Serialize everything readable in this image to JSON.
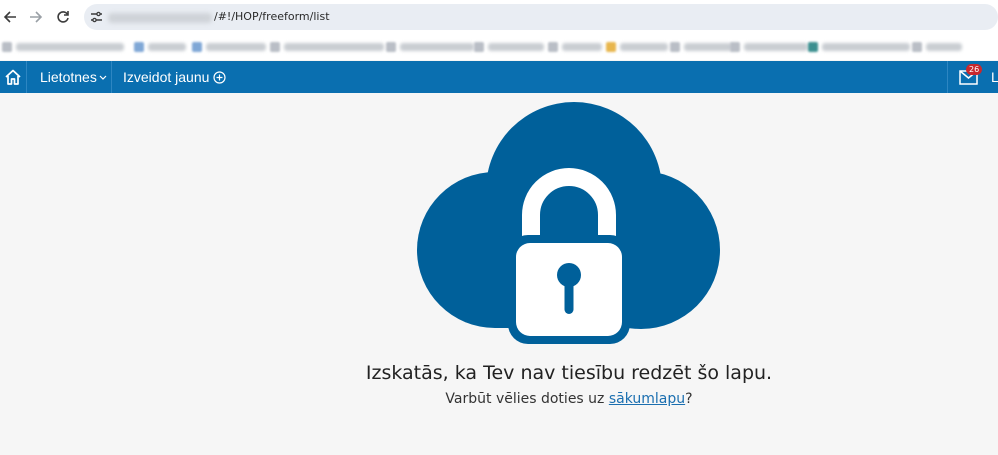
{
  "browser": {
    "url_visible": "/#!/HOP/freeform/list"
  },
  "appbar": {
    "menu_apps": "Lietotnes",
    "menu_create": "Izveidot jaunu",
    "mail_count": "26",
    "user_truncated": "L"
  },
  "main": {
    "title": "Izskatās, ka Tev nav tiesību redzēt šo lapu.",
    "sub_prefix": "Varbūt vēlies doties uz ",
    "sub_link": "sākumlapu",
    "sub_suffix": "?"
  },
  "colors": {
    "brand": "#0a6fb0",
    "illustration": "#00609a",
    "badge": "#c9282d"
  }
}
